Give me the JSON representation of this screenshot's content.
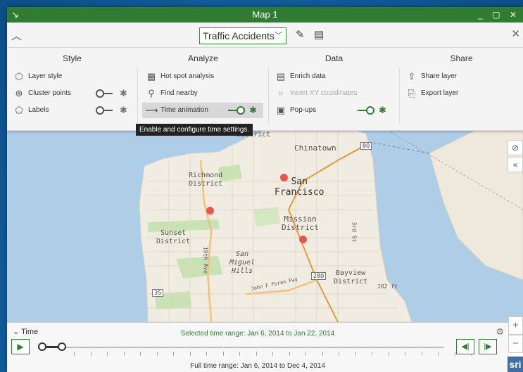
{
  "window": {
    "title": "Map 1"
  },
  "toolbar": {
    "layer": "Traffic Accidents"
  },
  "ribbon": {
    "style": {
      "title": "Style",
      "items": [
        {
          "label": "Layer style",
          "icon": "layer-style-icon"
        },
        {
          "label": "Cluster points",
          "icon": "cluster-points-icon",
          "toggle": "off"
        },
        {
          "label": "Labels",
          "icon": "labels-icon",
          "toggle": "off"
        }
      ]
    },
    "analyze": {
      "title": "Analyze",
      "items": [
        {
          "label": "Hot spot analysis",
          "icon": "hot-spot-icon"
        },
        {
          "label": "Find nearby",
          "icon": "find-nearby-icon"
        },
        {
          "label": "Time animation",
          "icon": "time-animation-icon",
          "toggle": "on"
        }
      ]
    },
    "data": {
      "title": "Data",
      "items": [
        {
          "label": "Enrich data",
          "icon": "enrich-data-icon"
        },
        {
          "label": "Insert XY coordinates",
          "icon": "insert-xy-icon",
          "disabled": true
        },
        {
          "label": "Pop-ups",
          "icon": "pop-ups-icon",
          "toggle": "on"
        }
      ]
    },
    "share": {
      "title": "Share",
      "items": [
        {
          "label": "Share layer",
          "icon": "share-layer-icon"
        },
        {
          "label": "Export layer",
          "icon": "export-layer-icon"
        }
      ]
    }
  },
  "tooltip": "Enable and configure time settings.",
  "map": {
    "labels": {
      "district": "District",
      "chinatown": "Chinatown",
      "richmond": "Richmond\nDistrict",
      "san_francisco": "San\nFrancisco",
      "mission": "Mission\nDistrict",
      "sunset": "Sunset\nDistrict",
      "san_miguel": "San\nMiguel\nHills",
      "bayview": "Bayview\nDistrict",
      "third_st": "3rd St",
      "nineteenth": "19th Ave",
      "john_f_foran": "John F Foran Fwy",
      "elevation": "162 ft"
    },
    "shields": {
      "i80": "80",
      "i280": "280",
      "ca35": "35"
    }
  },
  "time": {
    "label": "Time",
    "selected": "Selected time range:  Jan 6, 2014 to Jan 22, 2014",
    "full": "Full time range:  Jan 6, 2014 to Dec 4, 2014"
  },
  "colors": {
    "accent": "#2e7d32",
    "poi": "#ef5350",
    "water": "#aecde6"
  }
}
